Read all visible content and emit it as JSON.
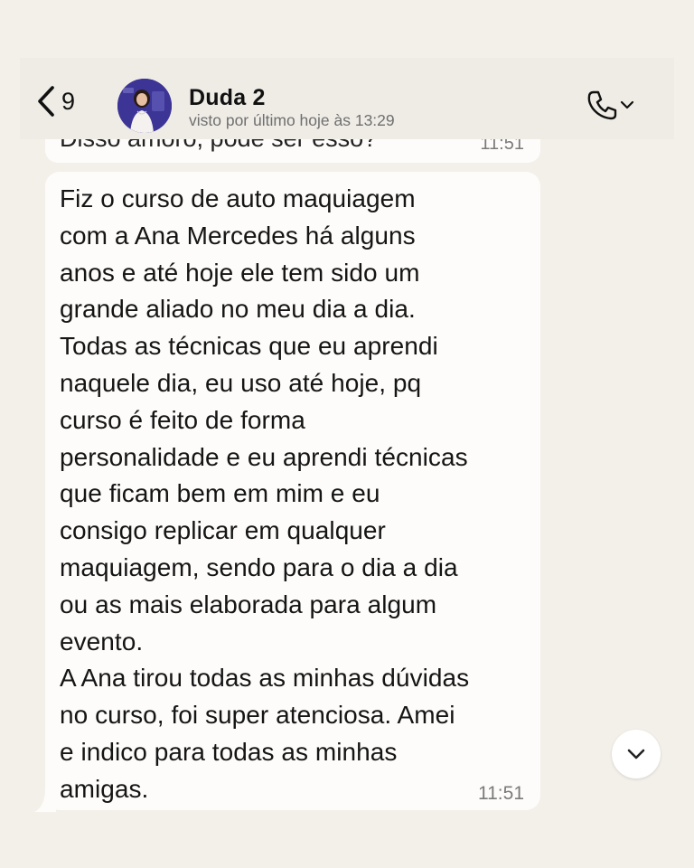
{
  "header": {
    "back_count": "9",
    "contact_name": "Duda 2",
    "status": "visto por último hoje às 13:29"
  },
  "previous_message": {
    "text": "Disso amoro, pode ser esso?",
    "time": "11:51"
  },
  "message": {
    "text": "Fiz o curso de auto maquiagem\ncom a Ana Mercedes há alguns\nanos e até hoje ele tem sido um\ngrande aliado no meu dia a dia.\nTodas as técnicas que eu aprendi\nnaquele dia, eu uso até hoje, pq\ncurso é feito de forma\npersonalidade e eu aprendi técnicas\nque ficam bem em mim e eu\nconsigo replicar em qualquer\nmaquiagem, sendo para o dia a dia\nou as mais elaborada para algum\nevento.\nA Ana tirou todas as minhas dúvidas\nno curso, foi super atenciosa. Amei\ne indico para todas as minhas\namigas.",
    "time": "11:51"
  },
  "icons": {
    "back": "chevron-left-icon",
    "call": "phone-icon",
    "call_menu": "chevron-down-icon",
    "scroll": "chevron-down-icon"
  },
  "colors": {
    "background": "#f3f0ea",
    "bubble": "#fdfcfa",
    "avatar_bg": "#3c3596"
  }
}
